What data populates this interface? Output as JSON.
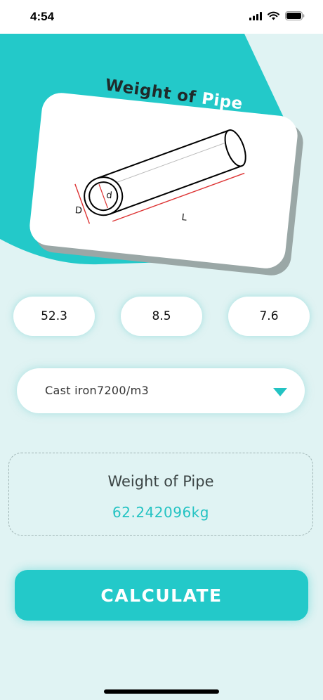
{
  "status_bar": {
    "time": "4:54"
  },
  "header": {
    "title_prefix": "Weight of ",
    "title_accent": "Pipe"
  },
  "diagram": {
    "label_outer": "D",
    "label_inner": "d",
    "label_length": "L"
  },
  "inputs": {
    "outer_diameter": "52.3",
    "inner_diameter": "8.5",
    "length": "7.6"
  },
  "material": {
    "selected": "Cast iron7200/m3"
  },
  "result": {
    "title": "Weight of Pipe",
    "value": "62.242096kg"
  },
  "calculate_label": "CALCULATE",
  "colors": {
    "accent": "#23c9c9",
    "background": "#e0f3f3",
    "result_text": "#23c3c3"
  }
}
